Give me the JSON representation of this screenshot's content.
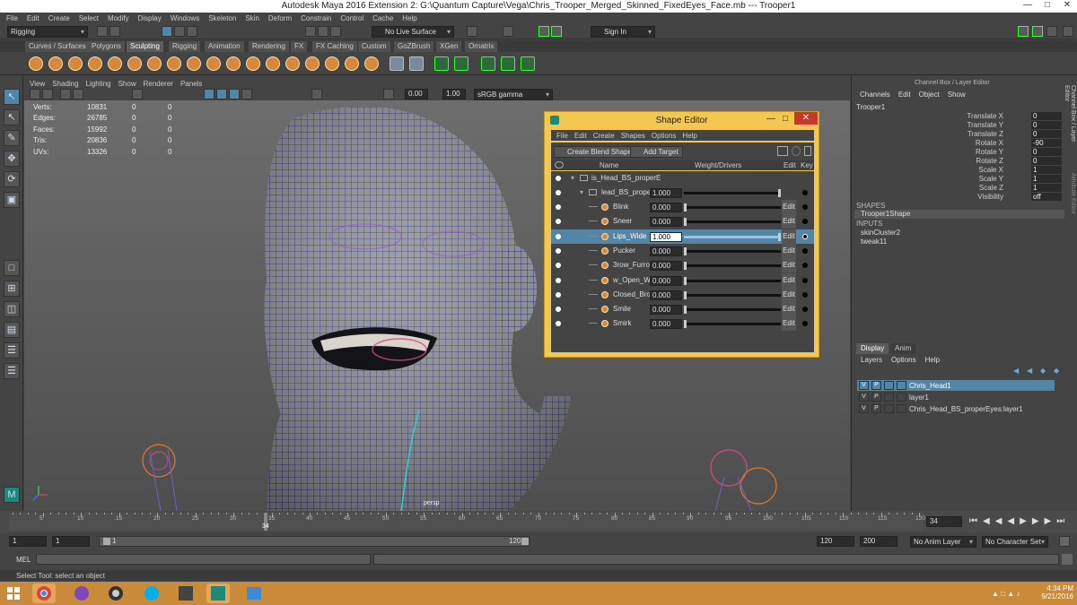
{
  "titlebar": {
    "title": "Autodesk Maya 2016 Extension 2: G:\\Quantum Capture\\Vega\\Chris_Trooper_Merged_Skinned_FixedEyes_Face.mb  ---  Trooper1"
  },
  "menubar": [
    "File",
    "Edit",
    "Create",
    "Select",
    "Modify",
    "Display",
    "Windows",
    "Skeleton",
    "Skin",
    "Deform",
    "Constrain",
    "Control",
    "Cache",
    "Help"
  ],
  "status_line": {
    "menuset": "Rigging",
    "live_surface": "No Live Surface",
    "sign_in": "Sign In"
  },
  "shelf_tabs": [
    "Curves / Surfaces",
    "Polygons",
    "Sculpting",
    "Rigging",
    "Animation",
    "Rendering",
    "FX",
    "FX Caching",
    "Custom",
    "GoZBrush",
    "XGen",
    "Ornatrix"
  ],
  "active_shelf": "Sculpting",
  "viewport": {
    "menus": [
      "View",
      "Shading",
      "Lighting",
      "Show",
      "Renderer",
      "Panels"
    ],
    "exposure": "0.00",
    "gamma": "1.00",
    "colorspace": "sRGB gamma",
    "camera": "persp",
    "hud": [
      {
        "label": "Verts:",
        "value": "10831",
        "c1": "0",
        "c2": "0"
      },
      {
        "label": "Edges:",
        "value": "26785",
        "c1": "0",
        "c2": "0"
      },
      {
        "label": "Faces:",
        "value": "15992",
        "c1": "0",
        "c2": "0"
      },
      {
        "label": "Tris:",
        "value": "20836",
        "c1": "0",
        "c2": "0"
      },
      {
        "label": "UVs:",
        "value": "13326",
        "c1": "0",
        "c2": "0"
      }
    ]
  },
  "shape_editor": {
    "title": "Shape Editor",
    "menus": [
      "File",
      "Edit",
      "Create",
      "Shapes",
      "Options",
      "Help"
    ],
    "create_blend_shape": "Create Blend Shape",
    "add_target": "Add Target",
    "columns": {
      "name": "Name",
      "weight": "Weight/Drivers",
      "edit": "Edit",
      "key": "Key"
    },
    "group": "is_Head_BS_properE",
    "blendshape": {
      "name": "lead_BS_properl",
      "weight": "1.000"
    },
    "targets": [
      {
        "name": "Blink",
        "weight": "0.000",
        "edit": "Edit",
        "selected": false
      },
      {
        "name": "Sneer",
        "weight": "0.000",
        "edit": "Edit",
        "selected": false
      },
      {
        "name": "Lips_Wide",
        "weight": "1.000",
        "edit": "Edit",
        "selected": true
      },
      {
        "name": "Pucker",
        "weight": "0.000",
        "edit": "Edit",
        "selected": false
      },
      {
        "name": "3row_Furrow",
        "weight": "0.000",
        "edit": "Edit",
        "selected": false
      },
      {
        "name": "w_Open_Wi",
        "weight": "0.000",
        "edit": "Edit",
        "selected": false
      },
      {
        "name": "Closed_Brow",
        "weight": "0.000",
        "edit": "Edit",
        "selected": false
      },
      {
        "name": "Smile",
        "weight": "0.000",
        "edit": "Edit",
        "selected": false
      },
      {
        "name": "Smirk",
        "weight": "0.000",
        "edit": "Edit",
        "selected": false
      }
    ]
  },
  "channel_box": {
    "header": "Channel Box / Layer Editor",
    "menus": [
      "Channels",
      "Edit",
      "Object",
      "Show"
    ],
    "object": "Trooper1",
    "attributes": [
      {
        "name": "Translate X",
        "value": "0"
      },
      {
        "name": "Translate Y",
        "value": "0"
      },
      {
        "name": "Translate Z",
        "value": "0"
      },
      {
        "name": "Rotate X",
        "value": "-90"
      },
      {
        "name": "Rotate Y",
        "value": "0"
      },
      {
        "name": "Rotate Z",
        "value": "0"
      },
      {
        "name": "Scale X",
        "value": "1"
      },
      {
        "name": "Scale Y",
        "value": "1"
      },
      {
        "name": "Scale Z",
        "value": "1"
      },
      {
        "name": "Visibility",
        "value": "off"
      }
    ],
    "shapes_label": "SHAPES",
    "shape": "Trooper1Shape",
    "inputs_label": "INPUTS",
    "inputs": [
      "skinCluster2",
      "tweak11"
    ],
    "side_tabs": [
      "Channel Box / Layer Editor",
      "Attribute Editor"
    ]
  },
  "layer_editor": {
    "tabs": [
      "Display",
      "Anim"
    ],
    "menus": [
      "Layers",
      "Options",
      "Help"
    ],
    "layers": [
      {
        "v": "V",
        "p": "P",
        "name": "Chris_Head1",
        "selected": true
      },
      {
        "v": "V",
        "p": "P",
        "name": "layer1",
        "selected": false
      },
      {
        "v": "V",
        "p": "P",
        "name": "Chris_Head_BS_properEyes:layer1",
        "selected": false
      }
    ]
  },
  "time_slider": {
    "ticks": [
      "5",
      "10",
      "15",
      "20",
      "25",
      "30",
      "35",
      "40",
      "45",
      "50",
      "55",
      "60",
      "65",
      "70",
      "75",
      "80",
      "85",
      "90",
      "95",
      "100",
      "105",
      "110",
      "115",
      "120"
    ],
    "current_frame": "34",
    "current_field": "34"
  },
  "range_slider": {
    "start": "1",
    "playback_start": "1",
    "range_start": "1",
    "range_end": "120",
    "playback_end": "120",
    "end": "200",
    "anim_layer": "No Anim Layer",
    "character_set": "No Character Set"
  },
  "command_line": {
    "label": "MEL"
  },
  "help_line": {
    "text": "Select Tool: select an object"
  },
  "taskbar": {
    "time": "4:34 PM",
    "date": "9/21/2016"
  },
  "colors": {
    "selection": "#5285a6",
    "shape_editor_frame": "#f3c851",
    "taskbar": "#c98a3a",
    "mesh_wire": "#1a1a8a"
  }
}
